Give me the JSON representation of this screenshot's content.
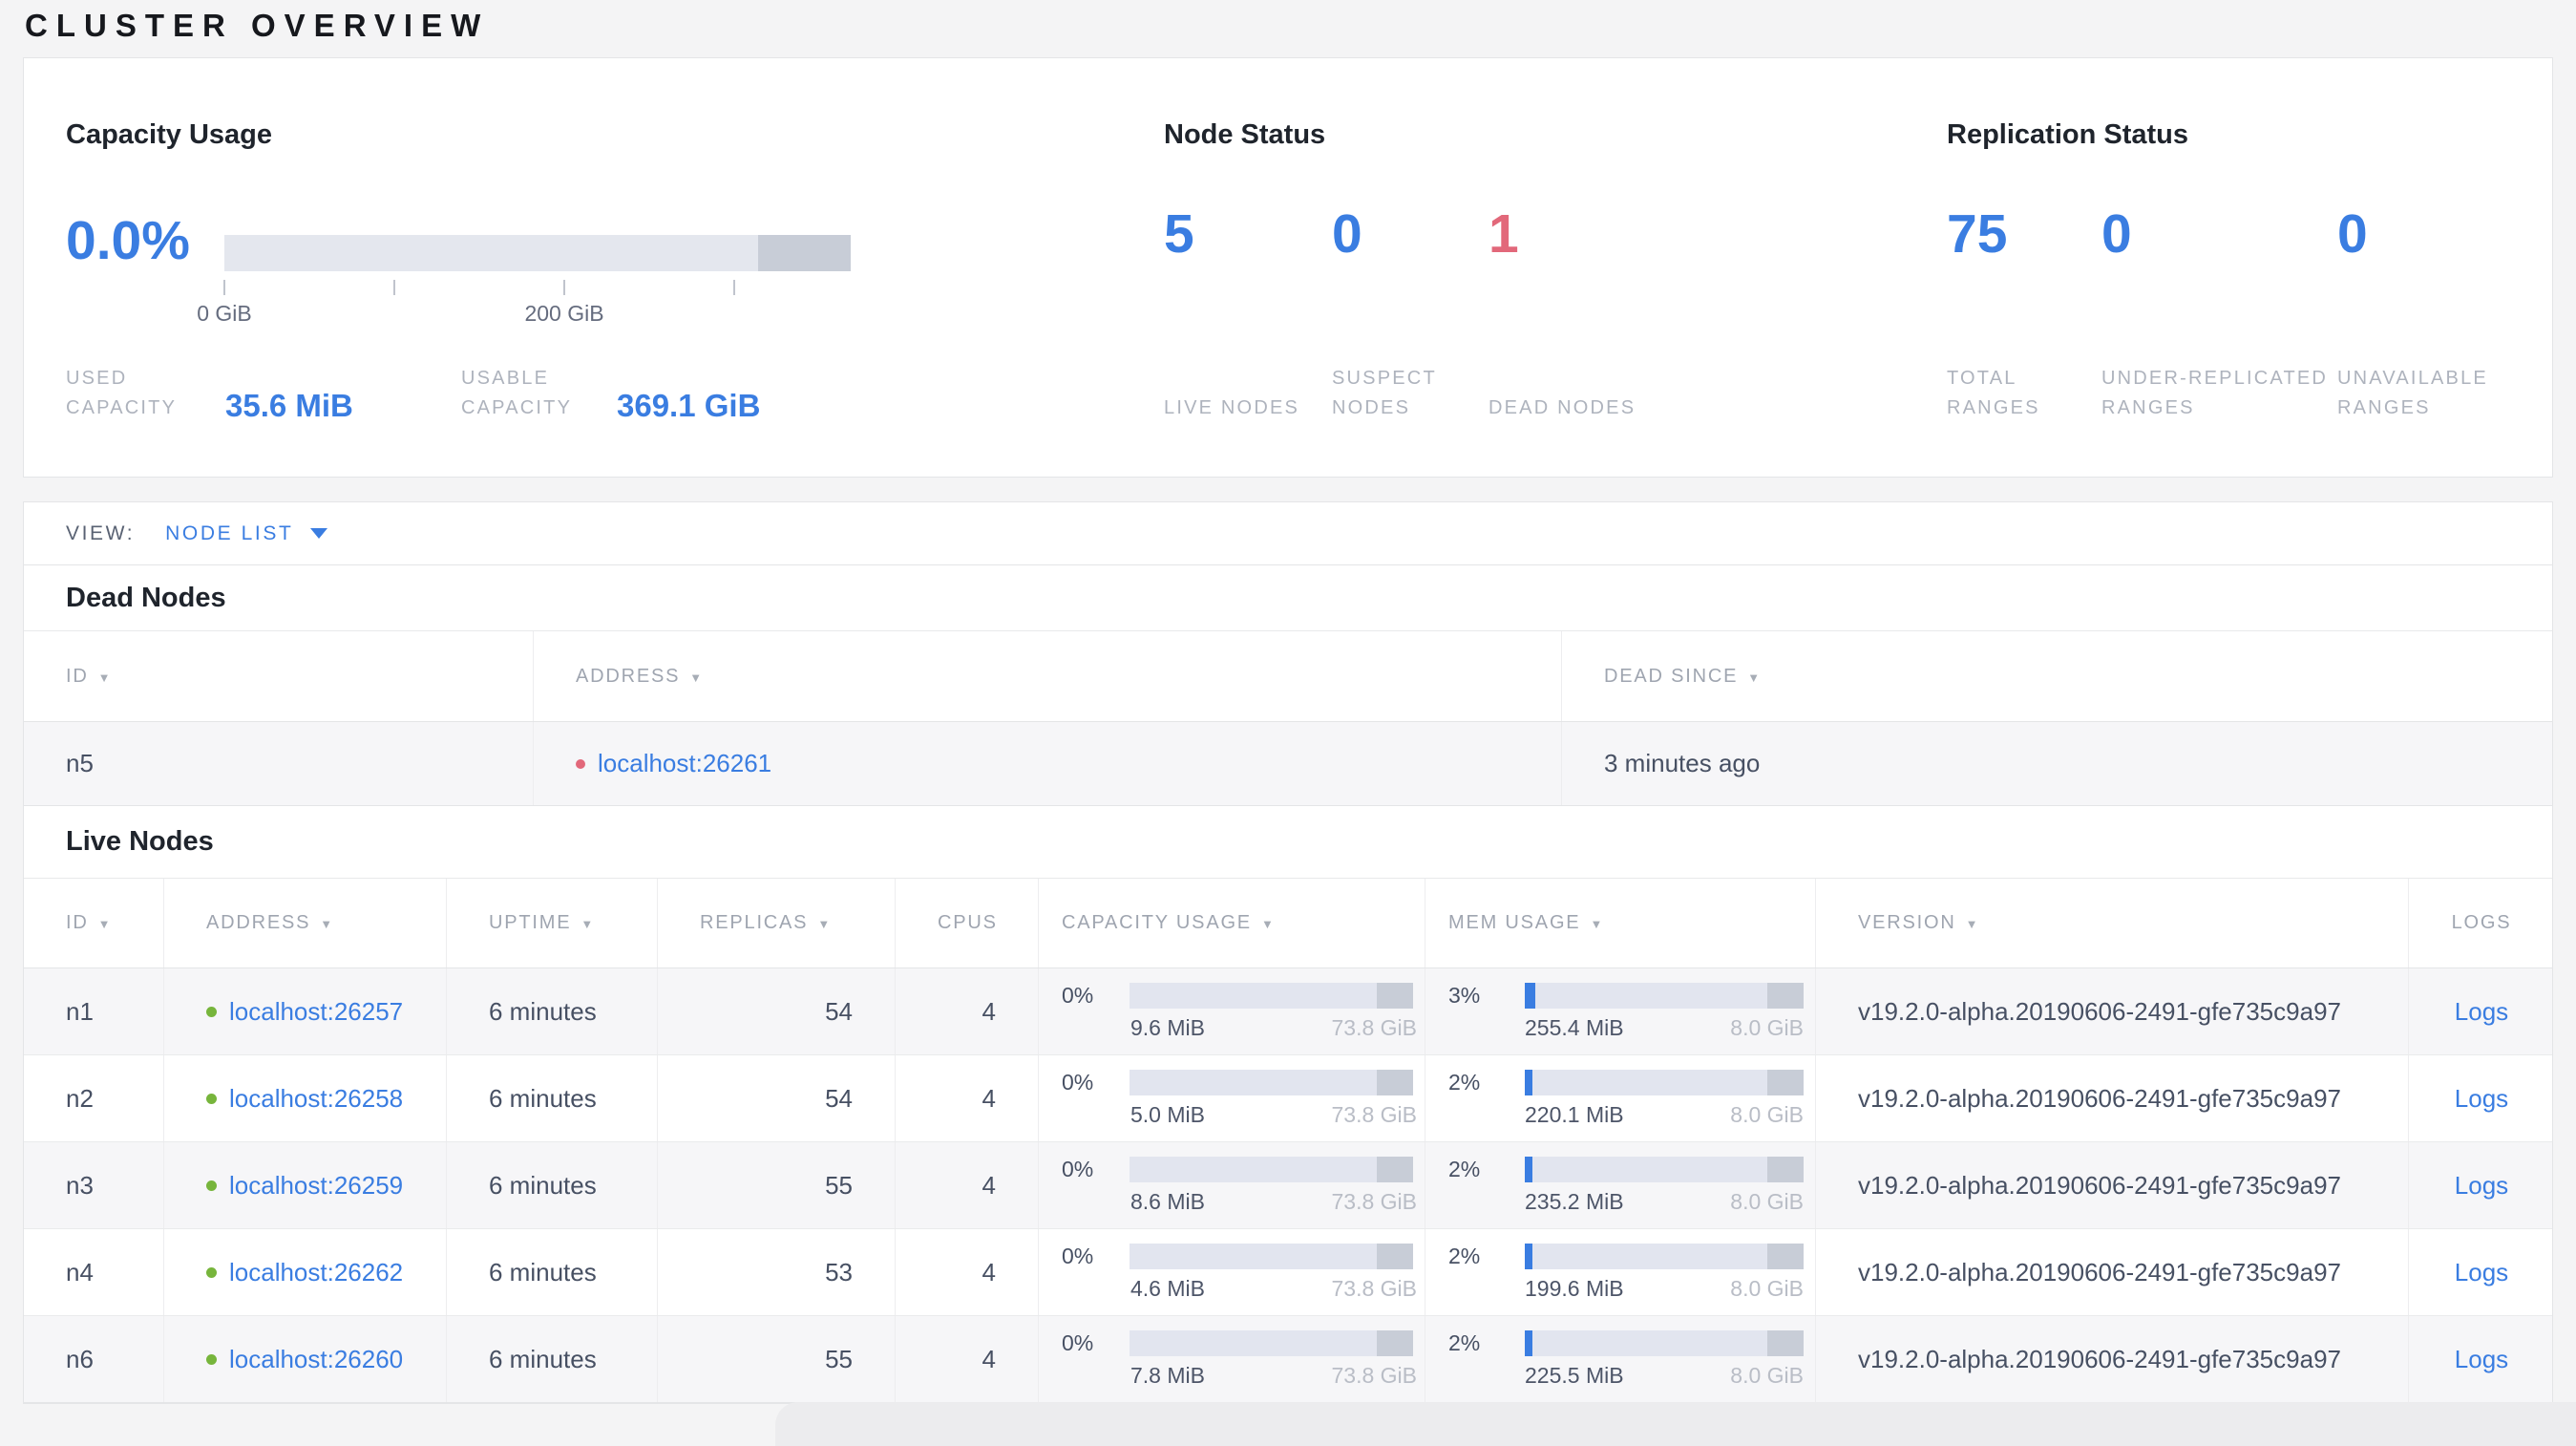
{
  "title": "CLUSTER OVERVIEW",
  "icons": {
    "sort_caret": "▼"
  },
  "colors": {
    "accent_blue": "#3a7de1",
    "dead_red": "#e2687a",
    "live_green": "#77b53c",
    "bar_track": "#e2e5ef",
    "bar_dark_segment": "#c8cdd7"
  },
  "summary": {
    "capacity": {
      "heading": "Capacity Usage",
      "percent": "0.0%",
      "tick_labels": [
        "0 GiB",
        "200 GiB"
      ],
      "used_label": "USED CAPACITY",
      "used_value": "35.6 MiB",
      "usable_label": "USABLE CAPACITY",
      "usable_value": "369.1 GiB"
    },
    "node_status": {
      "heading": "Node Status",
      "live_value": "5",
      "live_label": "LIVE NODES",
      "suspect_value": "0",
      "suspect_label": "SUSPECT NODES",
      "dead_value": "1",
      "dead_label": "DEAD NODES"
    },
    "replication": {
      "heading": "Replication Status",
      "total_value": "75",
      "total_label": "TOTAL RANGES",
      "under_value": "0",
      "under_label": "UNDER-REPLICATED RANGES",
      "unavailable_value": "0",
      "unavailable_label": "UNAVAILABLE RANGES"
    }
  },
  "view_bar": {
    "label": "VIEW:",
    "selected": "NODE LIST"
  },
  "dead_nodes": {
    "heading": "Dead Nodes",
    "columns": [
      "ID",
      "ADDRESS",
      "DEAD SINCE"
    ],
    "rows": [
      {
        "id": "n5",
        "address": "localhost:26261",
        "dead_since": "3 minutes ago"
      }
    ]
  },
  "live_nodes": {
    "heading": "Live Nodes",
    "columns": [
      "ID",
      "ADDRESS",
      "UPTIME",
      "REPLICAS",
      "CPUS",
      "CAPACITY USAGE",
      "MEM USAGE",
      "VERSION",
      "LOGS"
    ],
    "logs_label": "Logs",
    "rows": [
      {
        "id": "n1",
        "address": "localhost:26257",
        "uptime": "6 minutes",
        "replicas": "54",
        "cpus": "4",
        "cap_pct": "0%",
        "cap_used": "9.6 MiB",
        "cap_total": "73.8 GiB",
        "mem_pct": "3%",
        "mem_used": "255.4 MiB",
        "mem_total": "8.0 GiB",
        "version": "v19.2.0-alpha.20190606-2491-gfe735c9a97"
      },
      {
        "id": "n2",
        "address": "localhost:26258",
        "uptime": "6 minutes",
        "replicas": "54",
        "cpus": "4",
        "cap_pct": "0%",
        "cap_used": "5.0 MiB",
        "cap_total": "73.8 GiB",
        "mem_pct": "2%",
        "mem_used": "220.1 MiB",
        "mem_total": "8.0 GiB",
        "version": "v19.2.0-alpha.20190606-2491-gfe735c9a97"
      },
      {
        "id": "n3",
        "address": "localhost:26259",
        "uptime": "6 minutes",
        "replicas": "55",
        "cpus": "4",
        "cap_pct": "0%",
        "cap_used": "8.6 MiB",
        "cap_total": "73.8 GiB",
        "mem_pct": "2%",
        "mem_used": "235.2 MiB",
        "mem_total": "8.0 GiB",
        "version": "v19.2.0-alpha.20190606-2491-gfe735c9a97"
      },
      {
        "id": "n4",
        "address": "localhost:26262",
        "uptime": "6 minutes",
        "replicas": "53",
        "cpus": "4",
        "cap_pct": "0%",
        "cap_used": "4.6 MiB",
        "cap_total": "73.8 GiB",
        "mem_pct": "2%",
        "mem_used": "199.6 MiB",
        "mem_total": "8.0 GiB",
        "version": "v19.2.0-alpha.20190606-2491-gfe735c9a97"
      },
      {
        "id": "n6",
        "address": "localhost:26260",
        "uptime": "6 minutes",
        "replicas": "55",
        "cpus": "4",
        "cap_pct": "0%",
        "cap_used": "7.8 MiB",
        "cap_total": "73.8 GiB",
        "mem_pct": "2%",
        "mem_used": "225.5 MiB",
        "mem_total": "8.0 GiB",
        "version": "v19.2.0-alpha.20190606-2491-gfe735c9a97"
      }
    ]
  }
}
